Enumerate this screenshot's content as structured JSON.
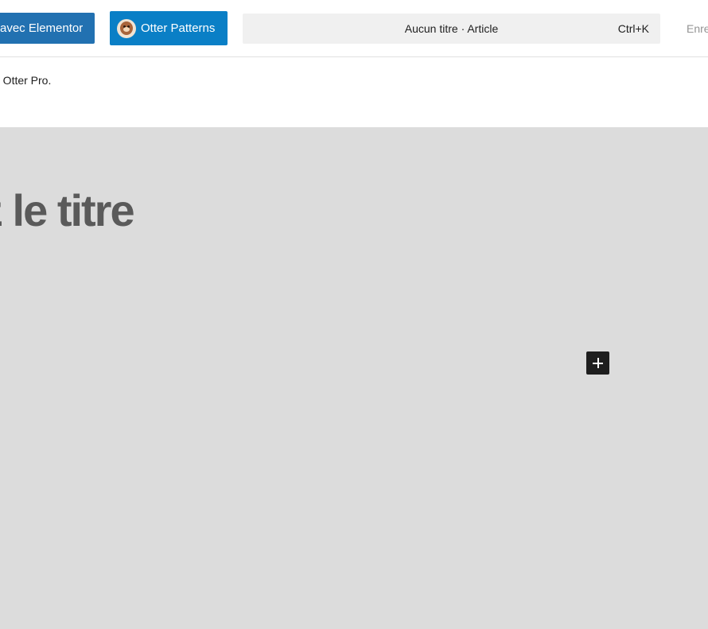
{
  "toolbar": {
    "elementor_button_label": "avec Elementor",
    "otter_button_label": "Otter Patterns",
    "command": {
      "title": "Aucun titre · Article",
      "shortcut": "Ctrl+K"
    },
    "save_label": "Enregistrer"
  },
  "notice": {
    "text": "h Otter Pro."
  },
  "editor": {
    "title_placeholder": "z le titre",
    "add_block_icon": "plus-icon"
  },
  "colors": {
    "primary": "#2271b1",
    "otter_blue": "#0a7fc6",
    "canvas_bg": "#dcdcdc",
    "command_bg": "#f0f0f0",
    "dark": "#1e1e1e"
  }
}
